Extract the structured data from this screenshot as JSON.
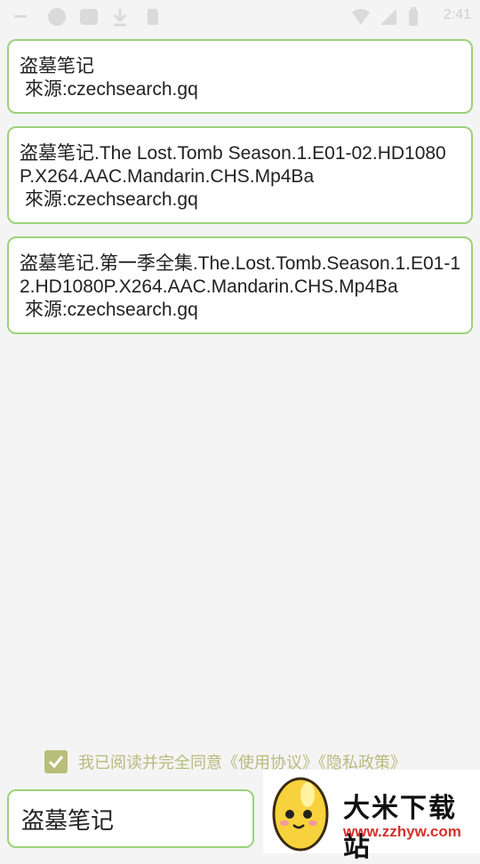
{
  "status_bar": {
    "time": "2:41"
  },
  "results": [
    {
      "title": "盗墓笔记",
      "source": " 來源:czechsearch.gq"
    },
    {
      "title": "盗墓笔记.The Lost.Tomb Season.1.E01-02.HD1080P.X264.AAC.Mandarin.CHS.Mp4Ba",
      "source": " 來源:czechsearch.gq"
    },
    {
      "title": "盗墓笔记.第一季全集.The.Lost.Tomb.Season.1.E01-12.HD1080P.X264.AAC.Mandarin.CHS.Mp4Ba",
      "source": " 來源:czechsearch.gq"
    }
  ],
  "agreement": {
    "checked": true,
    "text": "我已阅读并完全同意《使用协议》《隐私政策》"
  },
  "search": {
    "value": "盗墓笔记"
  },
  "watermark": {
    "name": "大米下载站",
    "url": "www.zzhyw.com"
  }
}
